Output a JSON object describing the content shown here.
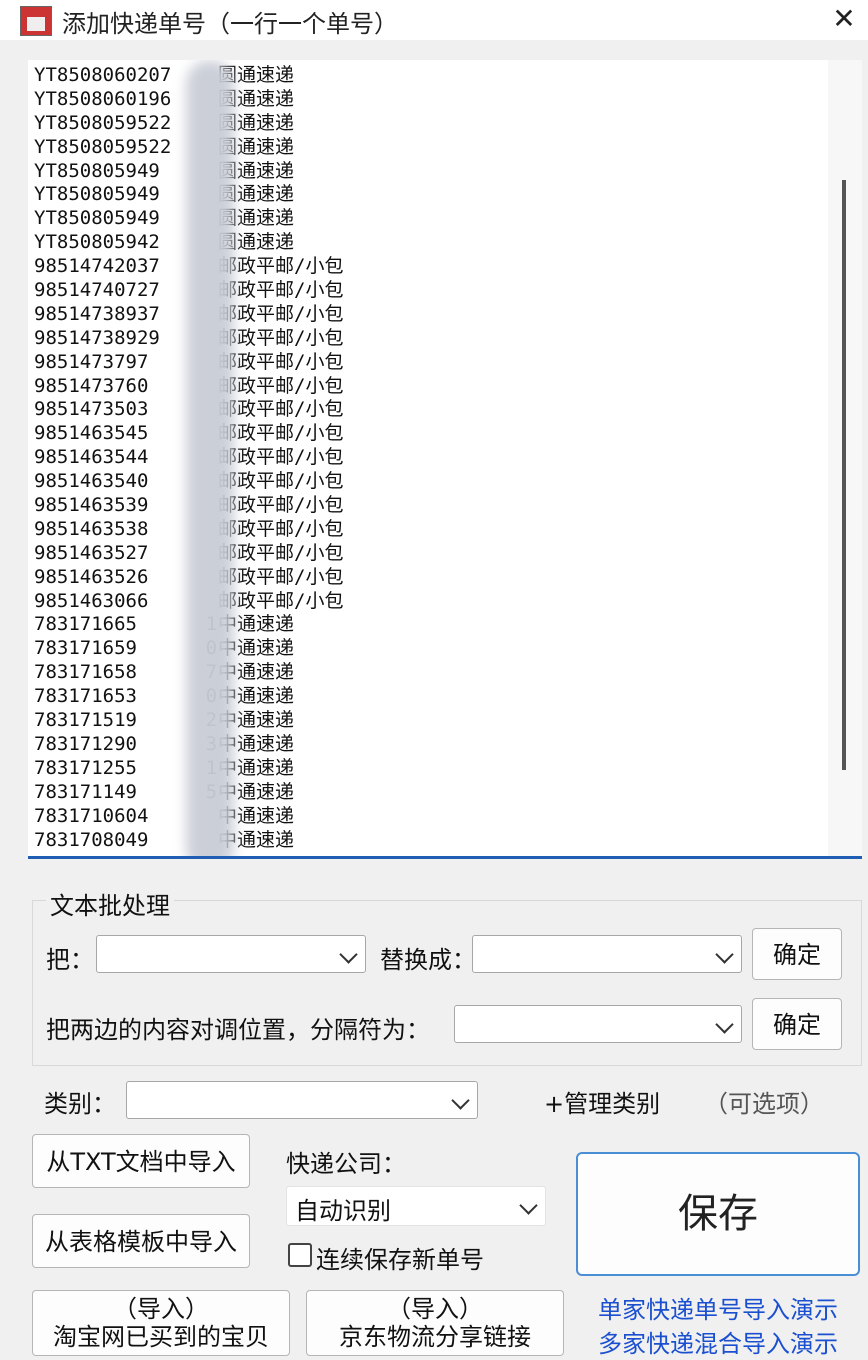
{
  "window": {
    "title": "添加快递单号（一行一个单号）",
    "close": "✕"
  },
  "editor": {
    "lines": [
      {
        "tn": "YT8508060207",
        "co": "圆通速递"
      },
      {
        "tn": "YT8508060196",
        "co": "圆通速递"
      },
      {
        "tn": "YT8508059522",
        "co": "圆通速递"
      },
      {
        "tn": "YT8508059522",
        "co": "圆通速递"
      },
      {
        "tn": "YT850805949",
        "co": "圆通速递"
      },
      {
        "tn": "YT850805949",
        "co": "圆通速递"
      },
      {
        "tn": "YT850805949",
        "co": "圆通速递"
      },
      {
        "tn": "YT850805942",
        "co": "圆通速递"
      },
      {
        "tn": "98514742037",
        "co": "邮政平邮/小包"
      },
      {
        "tn": "98514740727",
        "co": "邮政平邮/小包"
      },
      {
        "tn": "98514738937",
        "co": "邮政平邮/小包"
      },
      {
        "tn": "98514738929",
        "co": "邮政平邮/小包"
      },
      {
        "tn": "9851473797",
        "co": "邮政平邮/小包"
      },
      {
        "tn": "9851473760",
        "co": "邮政平邮/小包"
      },
      {
        "tn": "9851473503",
        "co": "邮政平邮/小包"
      },
      {
        "tn": "9851463545",
        "co": "邮政平邮/小包"
      },
      {
        "tn": "9851463544",
        "co": "邮政平邮/小包"
      },
      {
        "tn": "9851463540",
        "co": "邮政平邮/小包"
      },
      {
        "tn": "9851463539",
        "co": "邮政平邮/小包"
      },
      {
        "tn": "9851463538",
        "co": "邮政平邮/小包"
      },
      {
        "tn": "9851463527",
        "co": "邮政平邮/小包"
      },
      {
        "tn": "9851463526",
        "co": "邮政平邮/小包"
      },
      {
        "tn": "9851463066",
        "co": "邮政平邮/小包"
      },
      {
        "tn": "783171665      1",
        "co": "中通速递"
      },
      {
        "tn": "783171659      0",
        "co": "中通速递"
      },
      {
        "tn": "783171658      7",
        "co": "中通速递"
      },
      {
        "tn": "783171653      0",
        "co": "中通速递"
      },
      {
        "tn": "783171519      2",
        "co": "中通速递"
      },
      {
        "tn": "783171290      3",
        "co": "中通速递"
      },
      {
        "tn": "783171255      1",
        "co": "中通速递"
      },
      {
        "tn": "783171149      5",
        "co": "中通速递"
      },
      {
        "tn": "7831710604",
        "co": "中通速递"
      },
      {
        "tn": "7831708049",
        "co": "中通速递"
      }
    ]
  },
  "batch": {
    "group_title": "文本批处理",
    "replace_label": "把：",
    "replace_with_label": "替换成：",
    "replace_value": "",
    "replace_with_value": "",
    "confirm1": "确定",
    "swap_label": "把两边的内容对调位置，分隔符为：",
    "swap_value": "",
    "confirm2": "确定"
  },
  "category": {
    "label": "类别：",
    "value": "",
    "manage": "+管理类别",
    "optional": "（可选项）"
  },
  "buttons": {
    "import_txt": "从TXT文档中导入",
    "import_table": "从表格模板中导入",
    "taobao_l1": "（导入）",
    "taobao_l2": "淘宝网已买到的宝贝",
    "jd_l1": "（导入）",
    "jd_l2": "京东物流分享链接",
    "save": "保存"
  },
  "courier": {
    "label": "快递公司：",
    "value": "自动识别",
    "continuous": "连续保存新单号",
    "continuous_checked": false
  },
  "links": {
    "single_demo": "单家快递单号导入演示",
    "multi_demo": "多家快递混合导入演示"
  },
  "colors": {
    "accent": "#1e5fb4",
    "link": "#1a4fd0"
  }
}
